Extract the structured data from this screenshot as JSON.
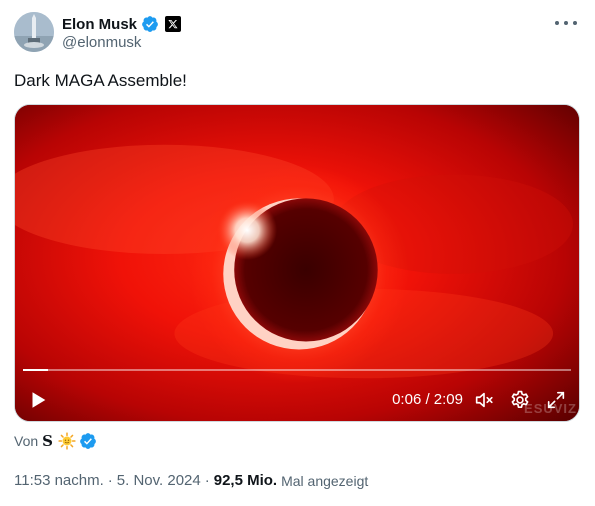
{
  "author": {
    "display_name": "Elon Musk",
    "handle": "@elonmusk",
    "verified_icon": "verified-badge-icon",
    "affiliation_icon": "x-logo-icon"
  },
  "tweet": {
    "text": "Dark MAGA Assemble!"
  },
  "video": {
    "current_time": "0:06",
    "duration": "2:09",
    "time_display": "0:06 / 2:09",
    "progress_fraction": 0.046,
    "watermark": "ESUVIZ"
  },
  "source": {
    "prefix": "Von",
    "name": "S"
  },
  "meta": {
    "time": "11:53 nachm.",
    "date": "5. Nov. 2024",
    "views_count": "92,5 Mio.",
    "views_label": "Mal angezeigt",
    "separator": "·"
  },
  "colors": {
    "accent": "#1d9bf0",
    "text_primary": "#0f1419",
    "text_secondary": "#536471",
    "video_red": "#ff1a0a"
  }
}
